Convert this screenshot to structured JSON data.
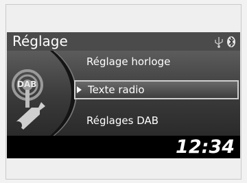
{
  "header": {
    "title": "Réglage",
    "usb_icon": "usb-icon",
    "bluetooth_icon": "bluetooth-icon"
  },
  "menu": {
    "items": [
      {
        "label": "Réglage horloge",
        "selected": false
      },
      {
        "label": "Texte radio",
        "selected": true
      },
      {
        "label": "Réglages DAB",
        "selected": false
      }
    ]
  },
  "side_icon": {
    "label": "DAB",
    "icon": "settings-wrench-icon"
  },
  "footer": {
    "clock": "12:34"
  },
  "colors": {
    "screen_bg": "#000000",
    "header_bg": "#4b4b4b",
    "text": "#ffffff",
    "frame": "#efefef"
  }
}
